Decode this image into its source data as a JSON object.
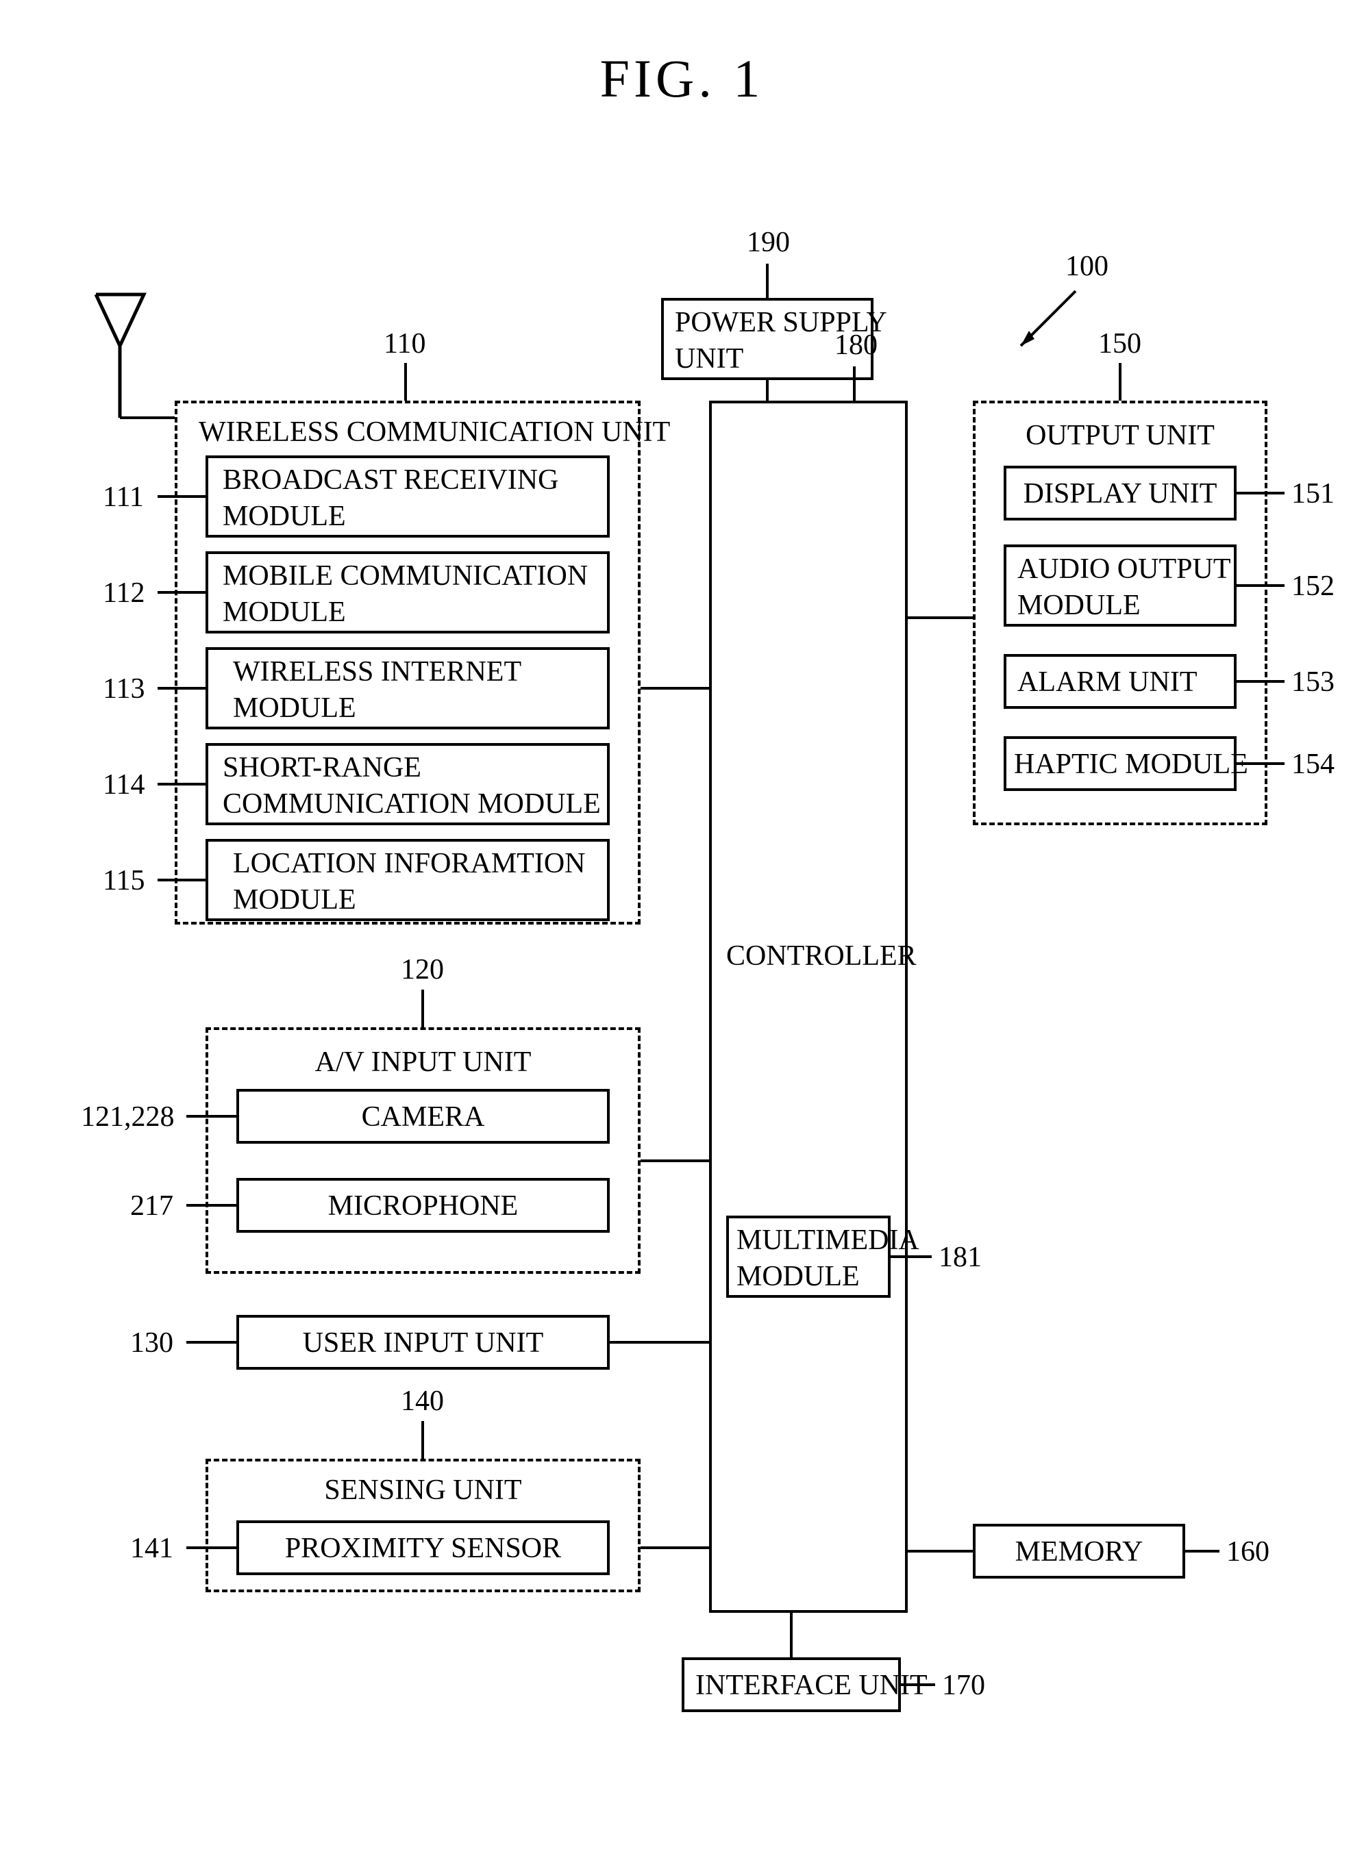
{
  "figure_title": "FIG. 1",
  "refs": {
    "r100": "100",
    "r110": "110",
    "r111": "111",
    "r112": "112",
    "r113": "113",
    "r114": "114",
    "r115": "115",
    "r120": "120",
    "r121_228": "121,228",
    "r217": "217",
    "r130": "130",
    "r140": "140",
    "r141": "141",
    "r150": "150",
    "r151": "151",
    "r152": "152",
    "r153": "153",
    "r154": "154",
    "r160": "160",
    "r170": "170",
    "r180": "180",
    "r181": "181",
    "r190": "190"
  },
  "blocks": {
    "power_supply": "POWER SUPPLY\nUNIT",
    "controller": "CONTROLLER",
    "multimedia": "MULTIMEDIA\nMODULE",
    "interface": "INTERFACE UNIT",
    "memory": "MEMORY",
    "wireless_unit_title": "WIRELESS COMMUNICATION UNIT",
    "broadcast": "BROADCAST RECEIVING\nMODULE",
    "mobile_comm": "MOBILE COMMUNICATION\nMODULE",
    "wireless_internet": "WIRELESS INTERNET\nMODULE",
    "short_range": "SHORT-RANGE\nCOMMUNICATION MODULE",
    "location": "LOCATION INFORAMTION\nMODULE",
    "av_title": "A/V INPUT UNIT",
    "camera": "CAMERA",
    "microphone": "MICROPHONE",
    "user_input": "USER INPUT UNIT",
    "sensing_title": "SENSING UNIT",
    "proximity": "PROXIMITY SENSOR",
    "output_title": "OUTPUT UNIT",
    "display": "DISPLAY UNIT",
    "audio_out": "AUDIO OUTPUT\nMODULE",
    "alarm": "ALARM UNIT",
    "haptic": "HAPTIC MODULE"
  }
}
